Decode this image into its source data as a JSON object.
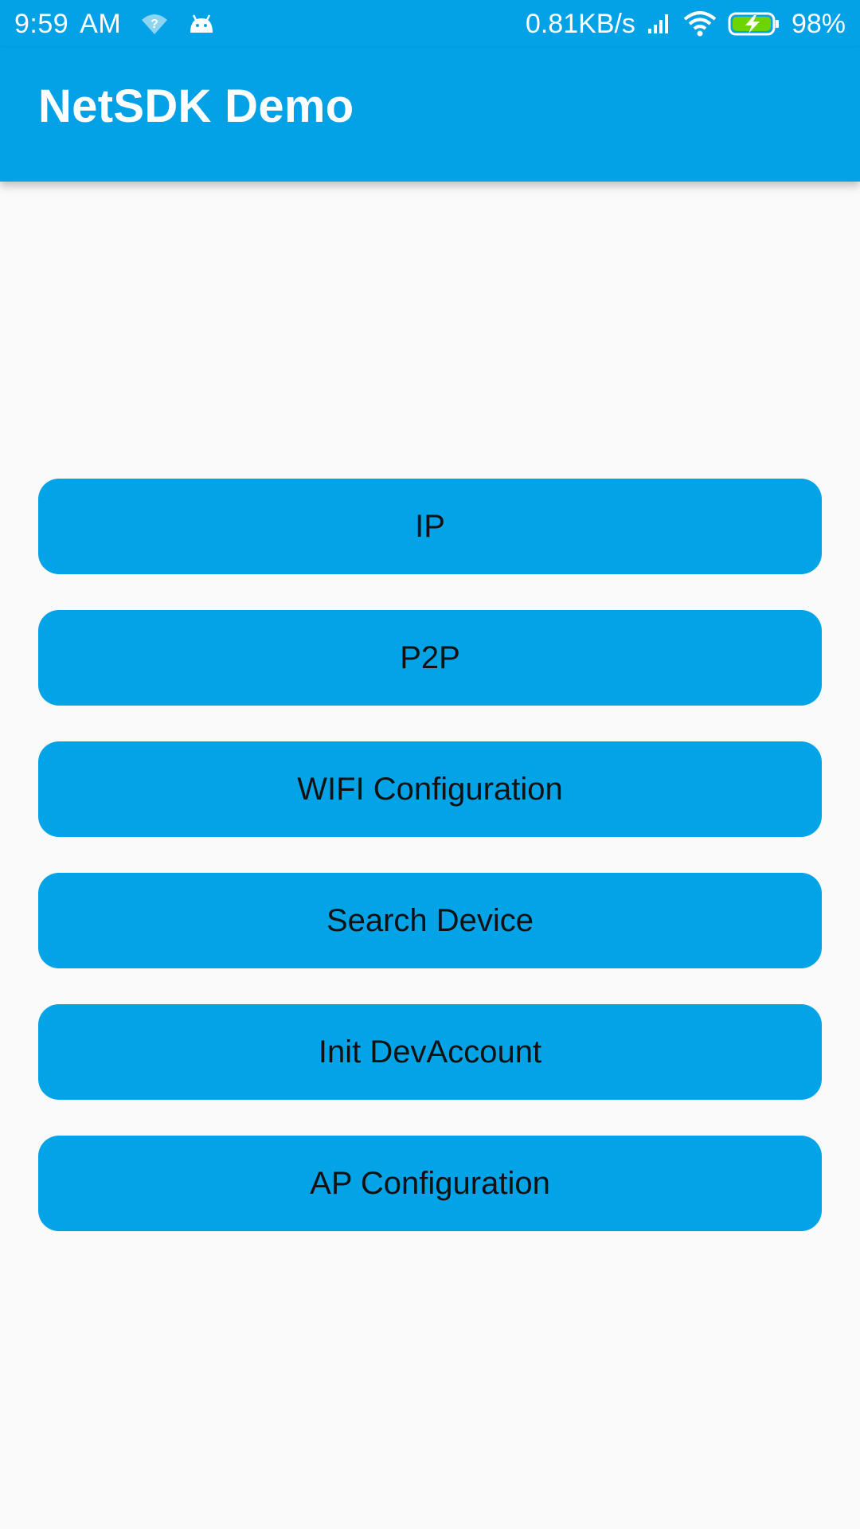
{
  "status_bar": {
    "time": "9:59",
    "ampm": "AM",
    "network_speed": "0.81KB/s",
    "battery_percent": "98%",
    "icons": [
      "wifi-question-icon",
      "android-icon",
      "signal-icon",
      "wifi-icon",
      "battery-charging-icon"
    ]
  },
  "app_bar": {
    "title": "NetSDK Demo",
    "color": "#03a1e5"
  },
  "buttons": [
    {
      "label": "IP"
    },
    {
      "label": "P2P"
    },
    {
      "label": "WIFI Configuration"
    },
    {
      "label": "Search Device"
    },
    {
      "label": "Init DevAccount"
    },
    {
      "label": "AP Configuration"
    }
  ],
  "colors": {
    "accent": "#03a1e5",
    "background": "#fafafa",
    "button_text": "#111111",
    "battery_fill": "#6dd400"
  }
}
